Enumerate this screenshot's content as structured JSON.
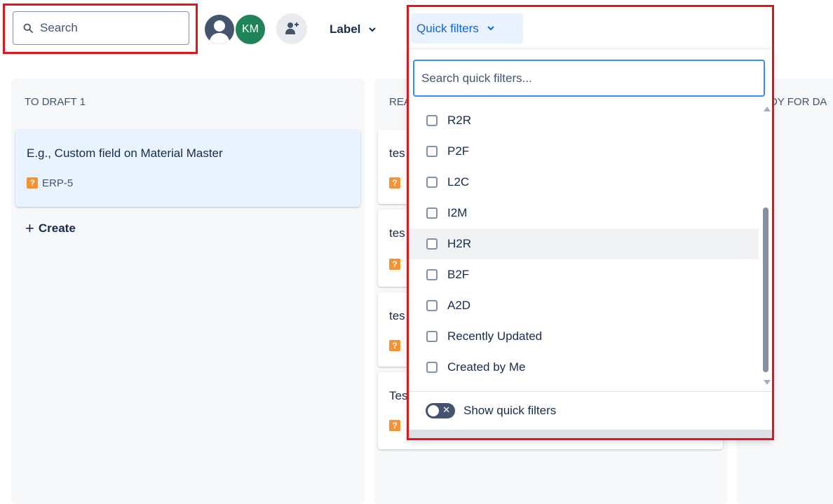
{
  "toolbar": {
    "search_placeholder": "Search",
    "avatar_initials": "KM",
    "label_filter": "Label",
    "quick_filters": "Quick filters"
  },
  "columns": [
    {
      "title": "TO DRAFT 1",
      "cards": [
        {
          "title": "E.g., Custom field on Material Master",
          "key": "ERP-5"
        }
      ],
      "create_label": "Create"
    },
    {
      "title": "REA",
      "cards": [
        {
          "title": "tes"
        },
        {
          "title": "tes"
        },
        {
          "title": "tes"
        },
        {
          "title": "Tes"
        }
      ]
    },
    {
      "title": "DY FOR DA"
    }
  ],
  "dropdown": {
    "search_placeholder": "Search quick filters...",
    "items": [
      "R2R",
      "P2F",
      "L2C",
      "I2M",
      "H2R",
      "B2F",
      "A2D",
      "Recently Updated",
      "Created by Me"
    ],
    "hovered_item": "H2R",
    "footer_toggle_label": "Show quick filters",
    "footer_toggle_on": false
  },
  "colors": {
    "highlight_box": "#e3141c",
    "accent_blue": "#0c66e4",
    "avatar_km": "#1f845a",
    "issue_icon": "#f79232"
  }
}
